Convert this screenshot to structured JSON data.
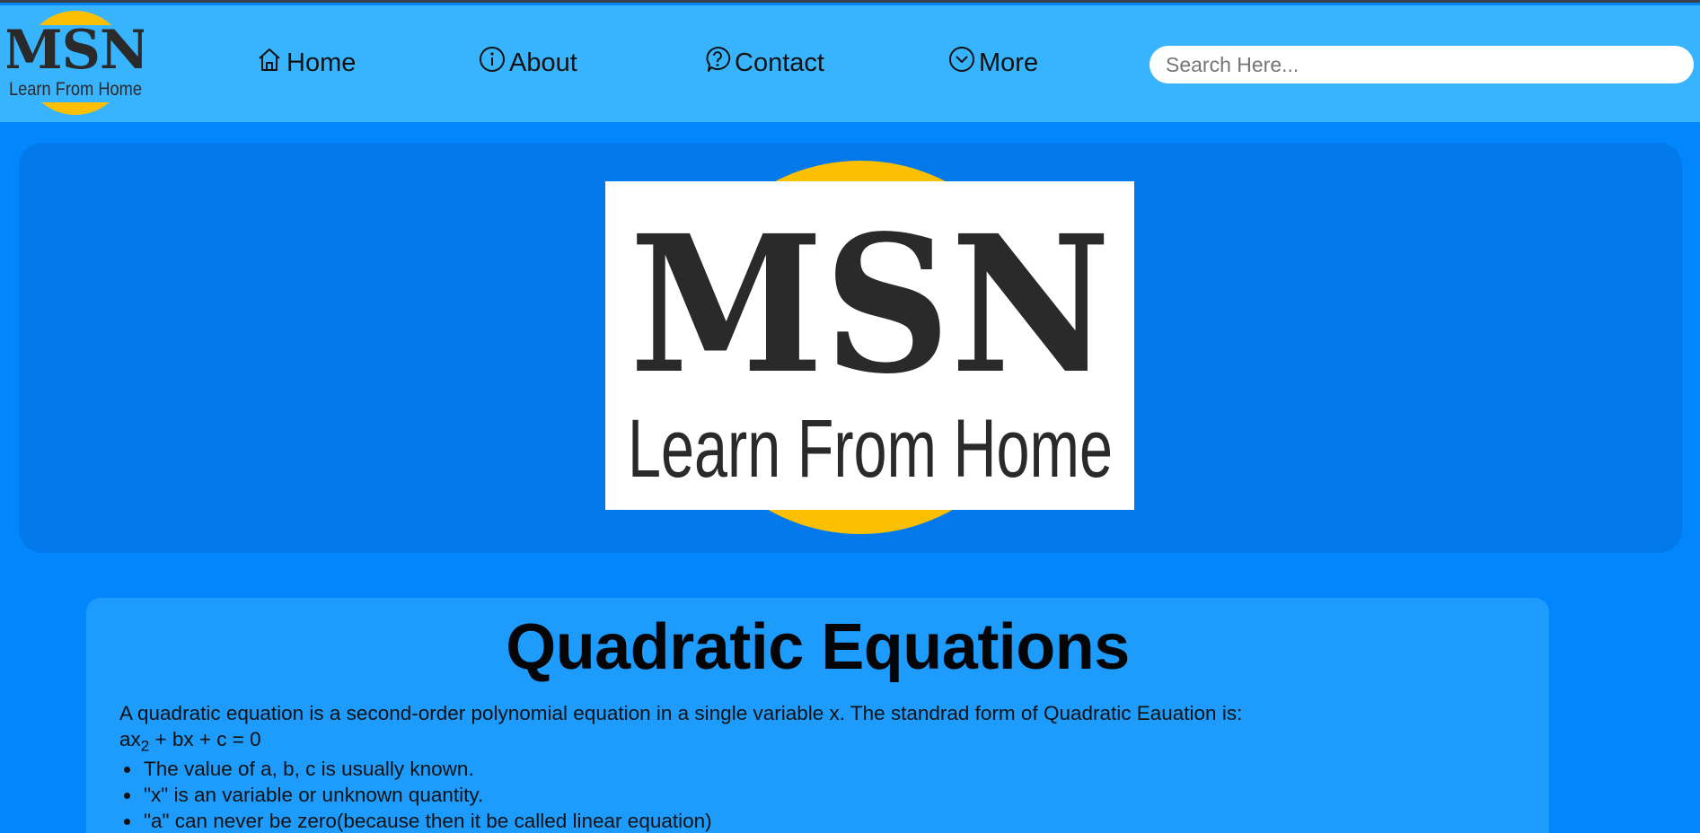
{
  "header": {
    "logo": {
      "title": "MSN",
      "tagline": "Learn From Home"
    },
    "nav": [
      {
        "label": "Home",
        "icon": "home-icon"
      },
      {
        "label": "About",
        "icon": "info-icon"
      },
      {
        "label": "Contact",
        "icon": "question-icon"
      },
      {
        "label": "More",
        "icon": "chevron-down-icon"
      }
    ],
    "search": {
      "placeholder": "Search Here...",
      "value": ""
    }
  },
  "hero": {
    "logo": {
      "title": "MSN",
      "tagline": "Learn From Home"
    }
  },
  "article": {
    "title": "Quadratic Equations",
    "intro": "A quadratic equation is a second-order polynomial equation in a single variable x. The standrad form of Quadratic Eauation is:",
    "formula": {
      "prefix": "ax",
      "sub": "2",
      "suffix": " + bx + c = 0"
    },
    "bullets": [
      "The value of a, b, c is usually known.",
      "\"x\" is an variable or unknown quantity.",
      "\"a\" can never be zero(because then it be called linear equation)"
    ]
  },
  "colors": {
    "page_bg": "#0186fb",
    "header_bg": "#38b4ff",
    "hero_bg": "#0279eb",
    "card_bg": "#1d9cfd",
    "logo_yellow": "#fbc004",
    "logo_dark": "#2a2a2a"
  }
}
